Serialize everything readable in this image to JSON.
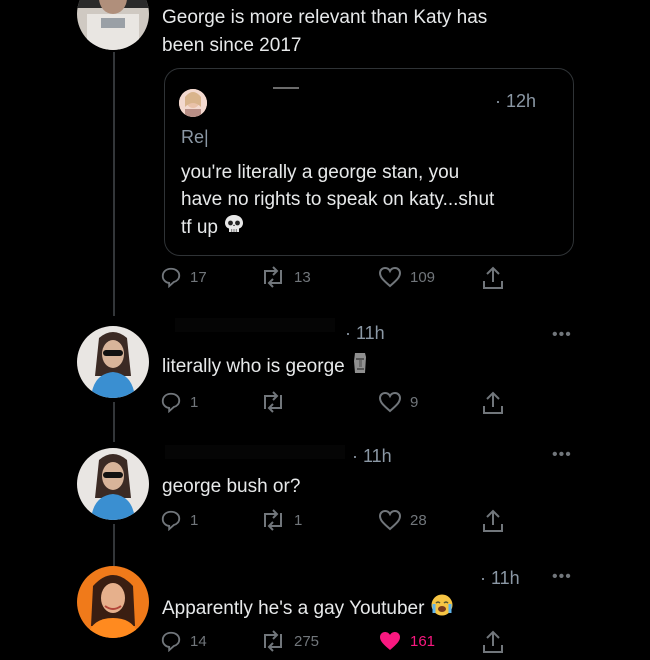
{
  "main_tweet": {
    "text_line1": "George is more relevant than Katy has",
    "text_line2": "been since 2017",
    "quote": {
      "time": "· 12h",
      "prefix": "Re|",
      "line1": "you're literally a george stan, you",
      "line2": "have no rights to speak on katy...shut",
      "line3": "tf up",
      "emoji_icon": "skull-icon"
    },
    "actions": {
      "replies": "17",
      "retweets": "13",
      "likes": "109"
    }
  },
  "replies": [
    {
      "time": "· 11h",
      "text": "literally who is george",
      "emoji_icon": "moai-icon",
      "actions": {
        "replies": "1",
        "retweets": "",
        "likes": "9"
      }
    },
    {
      "time": "· 11h",
      "text": "george bush or?",
      "actions": {
        "replies": "1",
        "retweets": "1",
        "likes": "28"
      }
    },
    {
      "time": "· 11h",
      "text": "Apparently he's a gay Youtuber",
      "emoji_icon": "crying-face-icon",
      "actions": {
        "replies": "14",
        "retweets": "275",
        "likes": "161"
      }
    }
  ],
  "more_label": "•••",
  "colors": {
    "like_active": "#f91880",
    "muted": "#71767b",
    "border": "#2f3336"
  }
}
